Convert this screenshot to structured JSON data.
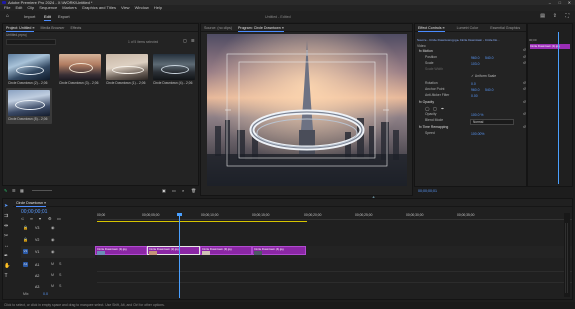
{
  "app": {
    "title": "Adobe Premiere Pro 2024 - X:\\WORK\\Untitled *"
  },
  "menu": [
    "File",
    "Edit",
    "Clip",
    "Sequence",
    "Markers",
    "Graphics and Titles",
    "View",
    "Window",
    "Help"
  ],
  "workspaces": {
    "import": "Import",
    "edit": "Edit",
    "export": "Export",
    "center_title": "Untitled - Edited"
  },
  "project_panel": {
    "tabs": [
      "Project: Untitled ≡",
      "Media Browser",
      "Effects"
    ],
    "path": "Untitled.prproj",
    "count": "1 of 5 items selected",
    "items": [
      {
        "name": "Circle Downtown (2)...",
        "dur": "2;06"
      },
      {
        "name": "Circle Downtown (3)...",
        "dur": "2;06"
      },
      {
        "name": "Circle Downtown (1)...",
        "dur": "2;06"
      },
      {
        "name": "Circle Downtown (4)...",
        "dur": "2;06"
      },
      {
        "name": "Circle Downtown (5)...",
        "dur": "2;06"
      }
    ]
  },
  "source_tab": "Source: (no clips)",
  "program": {
    "tab": "Program: Circle Downtown ≡",
    "timecode": "00;00;00;01",
    "fit": "Fit",
    "quality": "Full",
    "duration": "00;00;10;00"
  },
  "effect_controls": {
    "tabs": [
      "Effect Controls ≡",
      "Lumetri Color",
      "Essential Graphics",
      "Essential Sound"
    ],
    "header": "Source - Circle Downtown.jpg  ▸  Circle Downtown - Circle Do...",
    "video_label": "Video",
    "motion": "fx Motion",
    "props": [
      {
        "name": "Position",
        "v1": "960.0",
        "v2": "540.0"
      },
      {
        "name": "Scale",
        "v1": "103.0",
        "v2": ""
      },
      {
        "name": "Scale Width",
        "v1": "",
        "v2": ""
      },
      {
        "name": "",
        "v1": "",
        "v2": "✓ Uniform Scale"
      },
      {
        "name": "Rotation",
        "v1": "0.0",
        "v2": ""
      },
      {
        "name": "Anchor Point",
        "v1": "960.0",
        "v2": "540.0"
      },
      {
        "name": "Anti-flicker Filter",
        "v1": "0.00",
        "v2": ""
      }
    ],
    "opacity_label": "fx Opacity",
    "opacity": {
      "name": "Opacity",
      "v1": "100.0 %"
    },
    "blend": {
      "name": "Blend Mode",
      "v1": "Normal"
    },
    "time_remap": "fx Time Remapping",
    "speed": {
      "name": "Speed",
      "v1": "100.00%"
    },
    "clip_label": "Circle Downtown (1).jpg",
    "mini_time": "00;00",
    "timecode_bottom": "00;00;00;01"
  },
  "timeline": {
    "tab": "Circle Downtown ≡",
    "timecode": "00;00;00;01",
    "ruler": [
      "00;00",
      "00;00;05;00",
      "00;00;10;00",
      "00;00;15;00",
      "00;00;20;00",
      "00;00;25;00",
      "00;00;30;00",
      "00;00;35;00"
    ],
    "tracks_video": [
      "V3",
      "V2",
      "V1"
    ],
    "tracks_audio": [
      "A1",
      "A2",
      "A3"
    ],
    "mix": "Mix",
    "mix_value": "0.0",
    "clips": [
      {
        "label": "Circle Downtown (1).jpg"
      },
      {
        "label": "Circle Downtown (2).jpg"
      },
      {
        "label": "Circle Downtown (3).jpg"
      },
      {
        "label": "Circle Downtown (4).jpg"
      }
    ]
  },
  "status": "Click to select, or click in empty space and drag to marquee select. Use Shift, Alt, and Ctrl for other options.",
  "colors": {
    "accent": "#4a8bff",
    "clip": "#8b27a5",
    "playhead": "#4aa0ff"
  }
}
